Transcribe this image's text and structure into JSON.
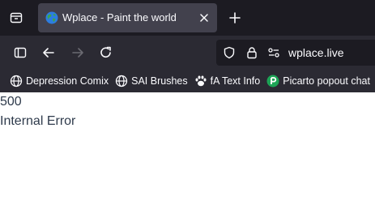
{
  "tab": {
    "title": "Wplace - Paint the world"
  },
  "url": {
    "host": "wplace.live"
  },
  "bookmarks": [
    {
      "label": "Depression Comix",
      "icon": "globe-icon"
    },
    {
      "label": "SAI Brushes",
      "icon": "globe-icon"
    },
    {
      "label": "fA Text Info",
      "icon": "paw-icon"
    },
    {
      "label": "Picarto popout chat",
      "icon": "picarto-icon"
    }
  ],
  "page": {
    "code": "500",
    "message": "Internal Error"
  },
  "colors": {
    "tabstrip": "#1c1b22",
    "toolbar": "#2b2a33",
    "active_tab": "#42414d",
    "picarto": "#1da456",
    "error_text": "#2f3b4c"
  }
}
